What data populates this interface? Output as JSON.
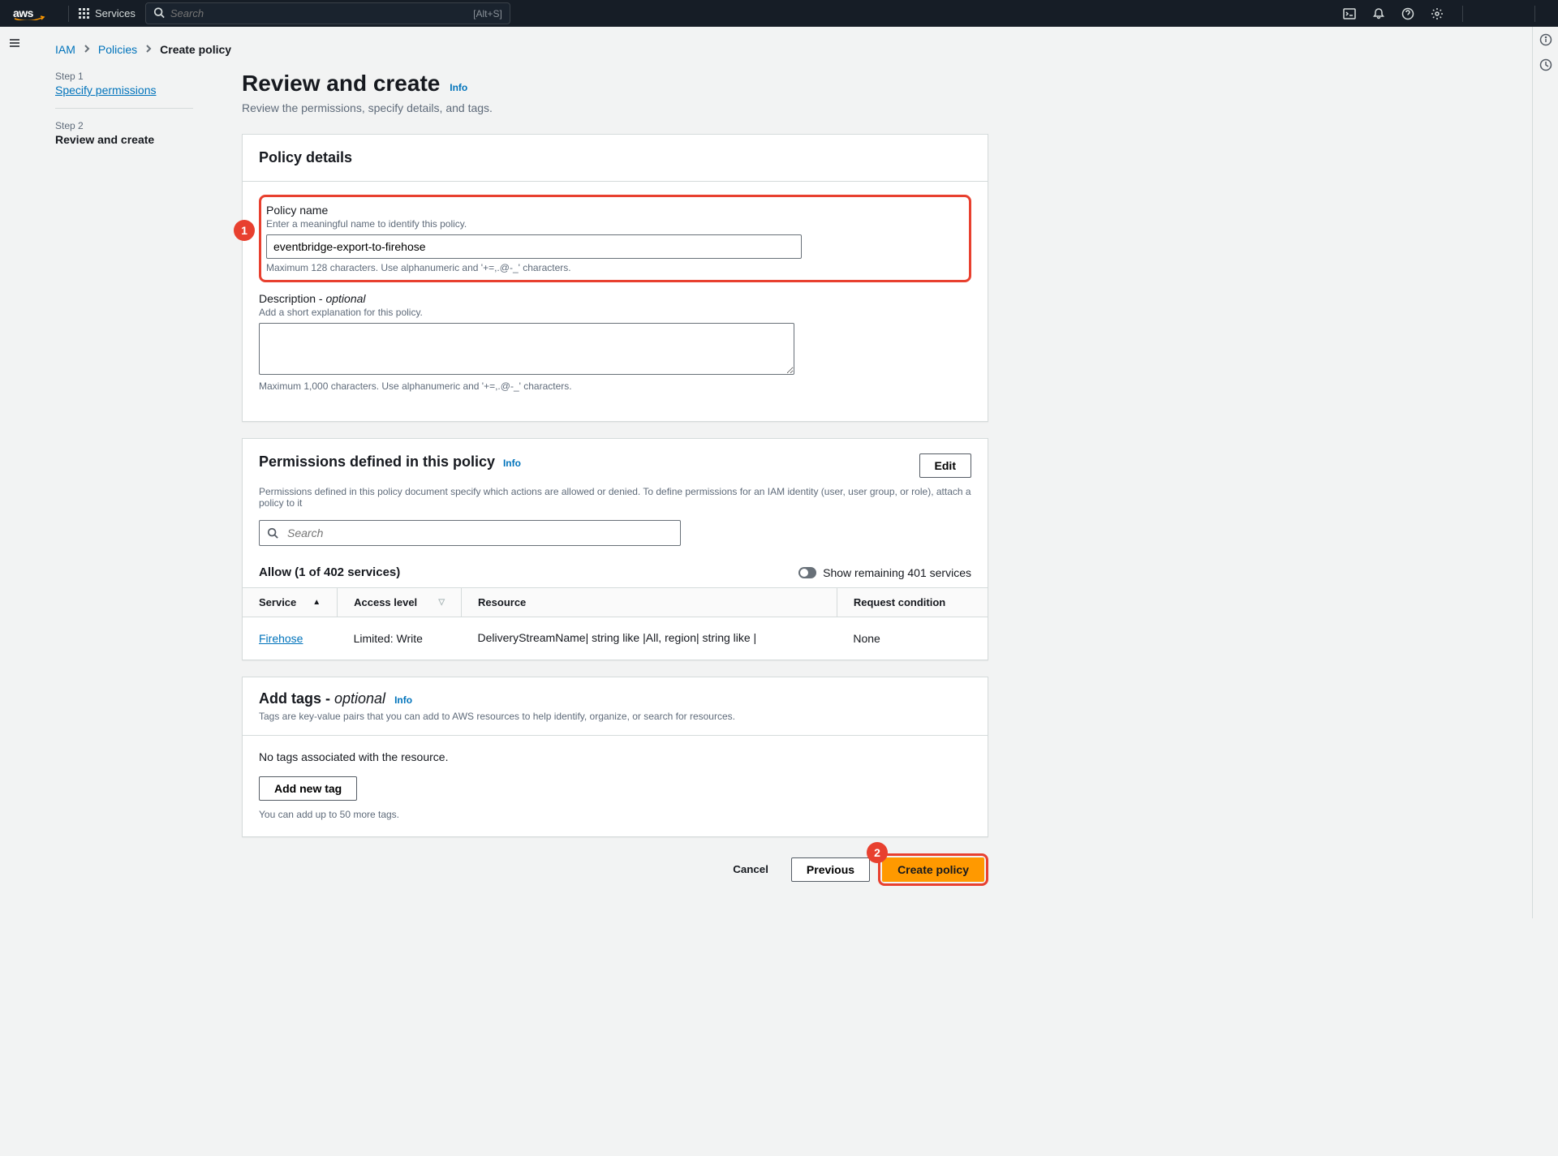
{
  "topbar": {
    "logo_alt": "aws",
    "services": "Services",
    "search_placeholder": "Search",
    "search_shortcut": "[Alt+S]"
  },
  "breadcrumb": {
    "iam": "IAM",
    "policies": "Policies",
    "current": "Create policy"
  },
  "wizard": {
    "step1_num": "Step 1",
    "step1_label": "Specify permissions",
    "step2_num": "Step 2",
    "step2_label": "Review and create"
  },
  "page": {
    "title": "Review and create",
    "info": "Info",
    "desc": "Review the permissions, specify details, and tags."
  },
  "policy_details": {
    "panel_title": "Policy details",
    "name_label": "Policy name",
    "name_help": "Enter a meaningful name to identify this policy.",
    "name_value": "eventbridge-export-to-firehose",
    "name_constraint": "Maximum 128 characters. Use alphanumeric and '+=,.@-_' characters.",
    "desc_label": "Description - ",
    "desc_optional": "optional",
    "desc_help": "Add a short explanation for this policy.",
    "desc_value": "",
    "desc_constraint": "Maximum 1,000 characters. Use alphanumeric and '+=,.@-_' characters."
  },
  "permissions": {
    "panel_title": "Permissions defined in this policy",
    "edit_btn": "Edit",
    "desc": "Permissions defined in this policy document specify which actions are allowed or denied. To define permissions for an IAM identity (user, user group, or role), attach a policy to it",
    "search_placeholder": "Search",
    "allow_title": "Allow (1 of 402 services)",
    "toggle_label": "Show remaining 401 services",
    "cols": {
      "service": "Service",
      "access": "Access level",
      "resource": "Resource",
      "condition": "Request condition"
    },
    "row": {
      "service": "Firehose",
      "access": "Limited: Write",
      "resource": "DeliveryStreamName| string like |All, region| string like |",
      "condition": "None"
    }
  },
  "tags": {
    "title_main": "Add tags - ",
    "title_optional": "optional",
    "desc": "Tags are key-value pairs that you can add to AWS resources to help identify, organize, or search for resources.",
    "none": "No tags associated with the resource.",
    "add_btn": "Add new tag",
    "constraint": "You can add up to 50 more tags."
  },
  "footer": {
    "cancel": "Cancel",
    "previous": "Previous",
    "create": "Create policy"
  },
  "annotations": {
    "badge1": "1",
    "badge2": "2"
  }
}
